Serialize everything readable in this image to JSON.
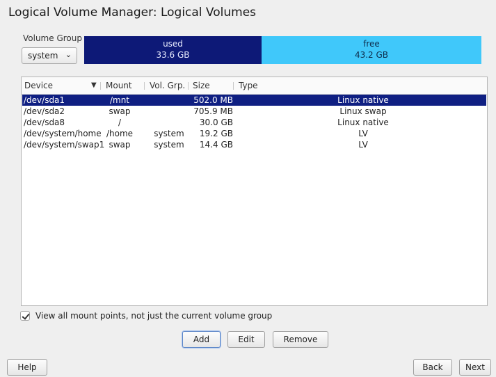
{
  "window": {
    "title": "Logical Volume Manager: Logical Volumes"
  },
  "volume_group": {
    "label": "Volume Group",
    "selected": "system",
    "used": {
      "label": "used",
      "size": "33.6 GB"
    },
    "free": {
      "label": "free",
      "size": "43.2 GB"
    }
  },
  "table": {
    "columns": [
      "Device",
      "Mount",
      "Vol. Grp.",
      "Size",
      "Type"
    ],
    "rows": [
      {
        "device": "/dev/sda1",
        "mount": "/mnt",
        "vg": "",
        "size": "502.0 MB",
        "type": "Linux native",
        "selected": true
      },
      {
        "device": "/dev/sda2",
        "mount": "swap",
        "vg": "",
        "size": "705.9 MB",
        "type": "Linux swap"
      },
      {
        "device": "/dev/sda8",
        "mount": "/",
        "vg": "",
        "size": "30.0 GB",
        "type": "Linux native"
      },
      {
        "device": "/dev/system/home",
        "mount": "/home",
        "vg": "system",
        "size": "19.2 GB",
        "type": "LV"
      },
      {
        "device": "/dev/system/swap1",
        "mount": "swap",
        "vg": "system",
        "size": "14.4 GB",
        "type": "LV"
      }
    ]
  },
  "view_all_checkbox": {
    "label": "View all mount points, not just the current volume group",
    "checked": true
  },
  "buttons": {
    "add": "Add",
    "edit": "Edit",
    "remove": "Remove",
    "help": "Help",
    "back": "Back",
    "next": "Next"
  },
  "icons": {
    "sort": "chevron-down-icon",
    "dropdown": "chevron-down-icon",
    "check": "checkmark-icon"
  },
  "colors": {
    "used_bar": "#0d1977",
    "free_bar": "#40c8fa",
    "selection": "#0f1f82"
  }
}
